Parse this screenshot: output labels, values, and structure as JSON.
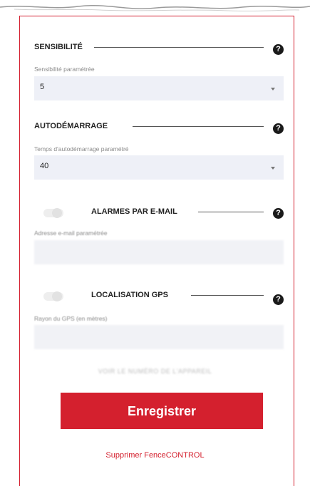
{
  "sensibilite": {
    "title": "SENSIBILITÉ",
    "field_label": "Sensibilité paramétrée",
    "value": "5"
  },
  "autodemarrage": {
    "title": "AUTODÉMARRAGE",
    "field_label": "Temps d'autodémarrage paramétré",
    "value": "40"
  },
  "alarmes": {
    "title": "ALARMES PAR E-MAIL",
    "field_label": "Adresse e-mail paramétrée",
    "value": "",
    "enabled": false
  },
  "gps": {
    "title": "LOCALISATION GPS",
    "field_label": "Rayon du GPS (en mètres)",
    "value": "",
    "enabled": false
  },
  "help_glyph": "?",
  "blurred_text": "VOIR LE NUMÉRO DE L'APPAREIL",
  "save_button": "Enregistrer",
  "delete_link": "Supprimer FenceCONTROL",
  "colors": {
    "accent": "#d4202e",
    "field_bg": "#eef0f7"
  }
}
